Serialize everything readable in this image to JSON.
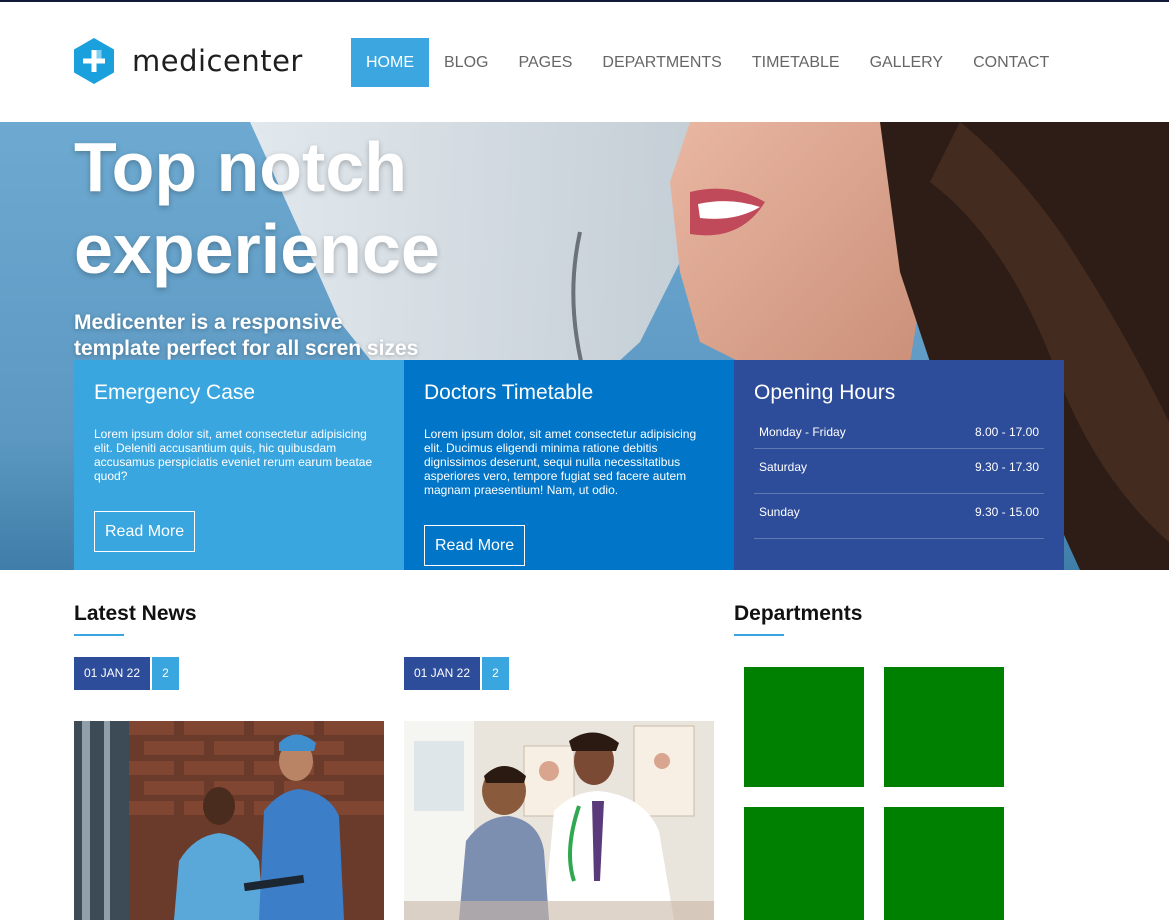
{
  "logo": {
    "text": "medicenter"
  },
  "nav": {
    "items": [
      {
        "label": "HOME",
        "active": true
      },
      {
        "label": "BLOG"
      },
      {
        "label": "PAGES"
      },
      {
        "label": "DEPARTMENTS"
      },
      {
        "label": "TIMETABLE"
      },
      {
        "label": "GALLERY"
      },
      {
        "label": "CONTACT"
      }
    ]
  },
  "hero": {
    "title_line1": "Top notch",
    "title_line2": "experience",
    "subtitle_line1": "Medicenter is a responsive",
    "subtitle_line2": "template perfect for all scren sizes"
  },
  "boxes": {
    "emergency": {
      "title": "Emergency Case",
      "text": "Lorem ipsum dolor sit, amet consectetur adipisicing elit. Deleniti accusantium quis, hic quibusdam accusamus perspiciatis eveniet rerum earum beatae quod?",
      "button": "Read More"
    },
    "timetable": {
      "title": "Doctors Timetable",
      "text": "Lorem ipsum dolor, sit amet consectetur adipisicing elit. Ducimus eligendi minima ratione debitis dignissimos deserunt, sequi nulla necessitatibus asperiores vero, tempore fugiat sed facere autem magnam praesentium! Nam, ut odio.",
      "button": "Read More"
    },
    "hours": {
      "title": "Opening Hours",
      "rows": [
        {
          "day": "Monday - Friday",
          "time": "8.00 - 17.00"
        },
        {
          "day": "Saturday",
          "time": "9.30 - 17.30"
        },
        {
          "day": "Sunday",
          "time": "9.30 - 15.00"
        }
      ]
    }
  },
  "news": {
    "title": "Latest News",
    "items": [
      {
        "date": "01 JAN 22",
        "comments": "2"
      },
      {
        "date": "01 JAN 22",
        "comments": "2"
      }
    ]
  },
  "departments": {
    "title": "Departments",
    "tile_color": "#008000"
  },
  "colors": {
    "accent": "#3aa6e0",
    "blue": "#0175c7",
    "navy": "#2d4c9a"
  }
}
